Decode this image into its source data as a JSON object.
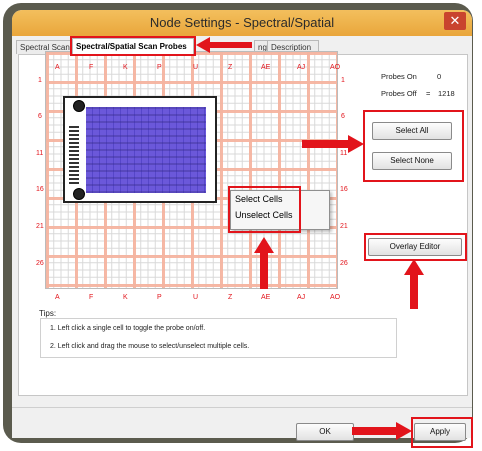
{
  "window": {
    "title": "Node Settings - Spectral/Spatial",
    "close_glyph": "✕"
  },
  "tabs": [
    {
      "label": "Spectral Scan"
    },
    {
      "label": "Spectral/Spatial Scan Probes"
    },
    {
      "label": "ng"
    },
    {
      "label": "Description"
    }
  ],
  "grid": {
    "cols": [
      "A",
      "F",
      "K",
      "P",
      "U",
      "Z",
      "AE",
      "AJ",
      "AO"
    ],
    "rows": [
      "1",
      "6",
      "11",
      "16",
      "21",
      "26"
    ]
  },
  "context_menu": {
    "items": [
      "Select Cells",
      "Unselect Cells"
    ]
  },
  "probes": {
    "on_label": "Probes On",
    "on_value": "0",
    "off_label": "Probes Off",
    "off_eq": "=",
    "off_value": "1218"
  },
  "buttons": {
    "select_all": "Select All",
    "select_none": "Select None",
    "overlay_editor": "Overlay Editor"
  },
  "tips": {
    "label": "Tips:",
    "items": [
      "1. Left click a single cell to toggle the probe on/off.",
      "2. Left click and drag the mouse to select/unselect multiple cells."
    ]
  },
  "footer": {
    "ok": "OK",
    "apply": "Apply"
  },
  "colors": {
    "highlight": "#e2141b",
    "title_bar": "#efb04c",
    "overlay": "#5544d8"
  },
  "icons": [
    "close-icon",
    "arrow-icon",
    "screw-icon"
  ]
}
